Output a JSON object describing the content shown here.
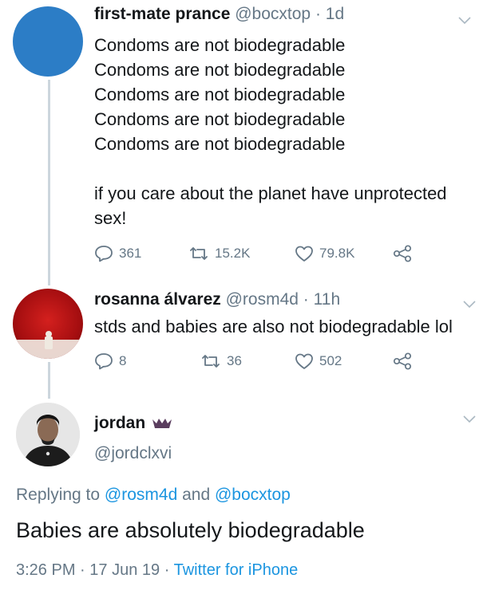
{
  "tweets": [
    {
      "name": "first-mate prance",
      "handle": "@bocxtop",
      "time": "1d",
      "body": "Condoms are not biodegradable\nCondoms are not biodegradable\nCondoms are not biodegradable\nCondoms are not biodegradable\nCondoms are not biodegradable\n\nif you care about the planet have unprotected\nsex!",
      "replies": "361",
      "retweets": "15.2K",
      "likes": "79.8K"
    },
    {
      "name": "rosanna álvarez",
      "handle": "@rosm4d",
      "time": "11h",
      "body": "stds and babies are also not biodegradable lol",
      "replies": "8",
      "retweets": "36",
      "likes": "502"
    }
  ],
  "main_tweet": {
    "name": "jordan",
    "handle": "@jordclxvi",
    "replying_prefix": "Replying to",
    "reply_to_1": "@rosm4d",
    "reply_and": "and",
    "reply_to_2": "@bocxtop",
    "text": "Babies are absolutely biodegradable",
    "time": "3:26 PM",
    "date": "17 Jun 19",
    "source": "Twitter for iPhone"
  },
  "separator": "·",
  "colors": {
    "link": "#1b95e0",
    "muted": "#657786",
    "text": "#14171a",
    "thread_line": "#ccd6dd",
    "avatar_blue": "#2c7dc6"
  },
  "icons": [
    "reply-icon",
    "retweet-icon",
    "like-icon",
    "share-icon",
    "chevron-down-icon",
    "crown-emoji-icon"
  ]
}
